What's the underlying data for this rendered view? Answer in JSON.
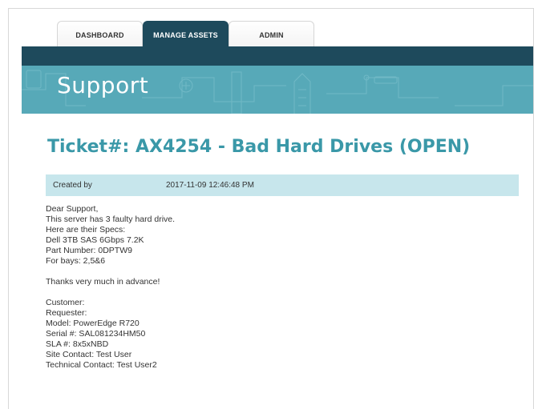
{
  "nav": {
    "tabs": [
      {
        "label": "DASHBOARD",
        "active": false
      },
      {
        "label": "MANAGE ASSETS",
        "active": true
      },
      {
        "label": "ADMIN",
        "active": false
      }
    ]
  },
  "banner": {
    "title": "Support"
  },
  "ticket": {
    "title": "Ticket#: AX4254 - Bad Hard Drives (OPEN)",
    "created_label": "Created by",
    "created_value": "2017-11-09 12:46:48 PM",
    "message": {
      "paragraph1": [
        "Dear Support,",
        "This server has 3 faulty hard drive.",
        "Here are their Specs:",
        "Dell 3TB SAS 6Gbps 7.2K",
        "Part Number: 0DPTW9",
        "For bays: 2,5&6"
      ],
      "paragraph2": [
        "Thanks very much in advance!"
      ],
      "paragraph3": [
        "Customer:",
        "Requester:",
        "Model: PowerEdge R720",
        "Serial #: SAL081234HM50",
        "SLA #: 8x5xNBD",
        "Site Contact: Test User",
        "Technical Contact: Test User2"
      ]
    }
  },
  "colors": {
    "navbar": "#1e4a5c",
    "banner": "#57a9b8",
    "title_accent": "#3a98a8",
    "meta_bar": "#c7e6ec"
  }
}
